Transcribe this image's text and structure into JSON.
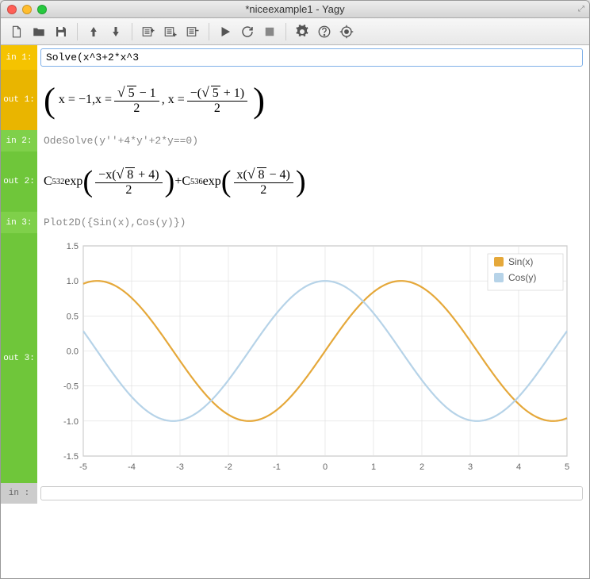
{
  "window": {
    "title": "*niceexample1 - Yagy"
  },
  "cells": {
    "in1_label": "in 1:",
    "in1_value": "Solve(x^3+2*x^3",
    "out1_label": "out 1:",
    "in2_label": "in  2:",
    "in2_value": "OdeSolve(y''+4*y'+2*y==0)",
    "out2_label": "out 2:",
    "in3_label": "in  3:",
    "in3_value": "Plot2D({Sin(x),Cos(y)})",
    "out3_label": "out 3:",
    "in_blank_label": "in  :"
  },
  "math": {
    "out1_x1": "x = −1,",
    "out1_x2_num_sqrt": "5",
    "out1_x2_num_minus1": " − 1",
    "out1_x2_den": "2",
    "out1_x2_prefix": "x = ",
    "out1_x3_prefix": " , x = ",
    "out1_x3_num_neg": "−(",
    "out1_x3_num_sqrt": "5",
    "out1_x3_num_plus1": " + 1)",
    "out1_x3_den": "2",
    "out2_c1": "C",
    "out2_c1sub": "532",
    "out2_exp": " exp",
    "out2_a_num_pre": "−x(",
    "out2_a_num_sqrt": "8",
    "out2_a_num_post": " + 4)",
    "out2_a_den": "2",
    "out2_plus": " + ",
    "out2_c2": "C",
    "out2_c2sub": "536",
    "out2_b_num_pre": "x(",
    "out2_b_num_sqrt": "8",
    "out2_b_num_post": " − 4)",
    "out2_b_den": "2"
  },
  "legend": {
    "sin": "Sin(x)",
    "cos": "Cos(y)"
  },
  "colors": {
    "sin": "#e5a83a",
    "cos": "#b6d3e8",
    "grid": "#ddd",
    "axis": "#888"
  },
  "chart_data": {
    "type": "line",
    "xlim": [
      -5,
      5
    ],
    "ylim": [
      -1.5,
      1.5
    ],
    "xticks": [
      -5,
      -4,
      -3,
      -2,
      -1,
      0,
      1,
      2,
      3,
      4,
      5
    ],
    "yticks": [
      -1.5,
      -1.0,
      -0.5,
      0.0,
      0.5,
      1.0,
      1.5
    ],
    "series": [
      {
        "name": "Sin(x)",
        "color": "#e5a83a",
        "fn": "sin"
      },
      {
        "name": "Cos(y)",
        "color": "#b6d3e8",
        "fn": "cos"
      }
    ]
  }
}
